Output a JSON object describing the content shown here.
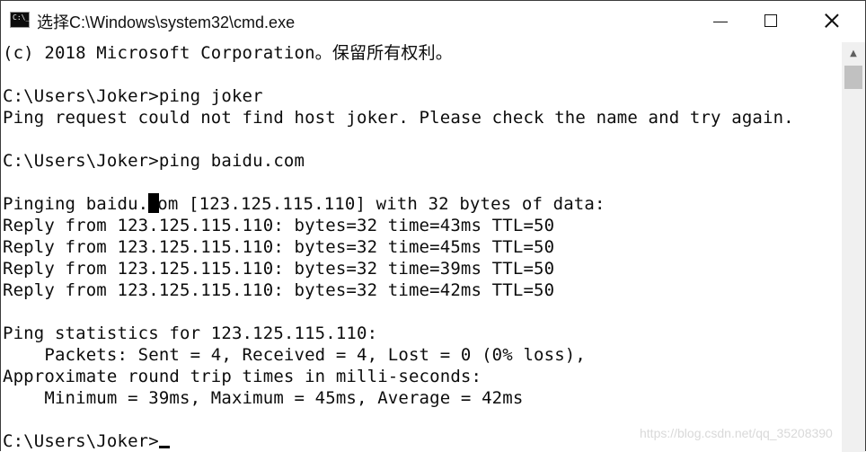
{
  "window": {
    "title": "选择C:\\Windows\\system32\\cmd.exe",
    "icons": {
      "app": "cmd-icon",
      "minimize": "minimize-icon",
      "maximize": "maximize-icon",
      "close": "close-icon"
    }
  },
  "console": {
    "lines": [
      "(c) 2018 Microsoft Corporation。保留所有权利。",
      "",
      "C:\\Users\\Joker>ping joker",
      "Ping request could not find host joker. Please check the name and try again.",
      "",
      "C:\\Users\\Joker>ping baidu.com",
      "",
      "Pinging baidu.com [123.125.115.110] with 32 bytes of data:",
      "Reply from 123.125.115.110: bytes=32 time=43ms TTL=50",
      "Reply from 123.125.115.110: bytes=32 time=45ms TTL=50",
      "Reply from 123.125.115.110: bytes=32 time=39ms TTL=50",
      "Reply from 123.125.115.110: bytes=32 time=42ms TTL=50",
      "",
      "Ping statistics for 123.125.115.110:",
      "    Packets: Sent = 4, Received = 4, Lost = 0 (0% loss),",
      "Approximate round trip times in milli-seconds:",
      "    Minimum = 39ms, Maximum = 45ms, Average = 42ms",
      "",
      "C:\\Users\\Joker>"
    ],
    "selection_line": {
      "before": "Pinging baidu.",
      "selected": "c",
      "after": "om [123.125.115.110] with 32 bytes of data:"
    }
  },
  "watermark": "https://blog.csdn.net/qq_35208390"
}
